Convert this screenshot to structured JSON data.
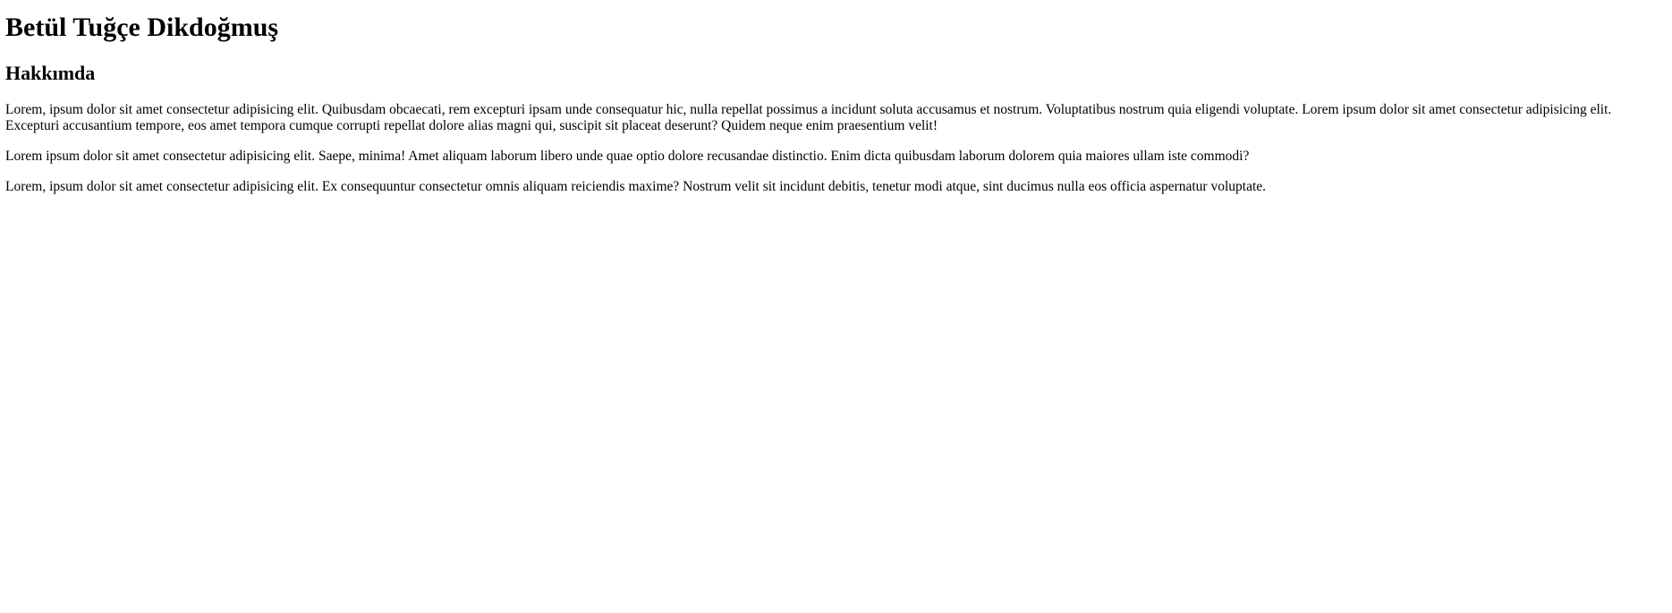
{
  "header": {
    "name": "Betül Tuğçe Dikdoğmuş"
  },
  "about": {
    "heading": "Hakkımda",
    "paragraphs": [
      "Lorem, ipsum dolor sit amet consectetur adipisicing elit. Quibusdam obcaecati, rem excepturi ipsam unde consequatur hic, nulla repellat possimus a incidunt soluta accusamus et nostrum. Voluptatibus nostrum quia eligendi voluptate. Lorem ipsum dolor sit amet consectetur adipisicing elit. Excepturi accusantium tempore, eos amet tempora cumque corrupti repellat dolore alias magni qui, suscipit sit placeat deserunt? Quidem neque enim praesentium velit!",
      "Lorem ipsum dolor sit amet consectetur adipisicing elit. Saepe, minima! Amet aliquam laborum libero unde quae optio dolore recusandae distinctio. Enim dicta quibusdam laborum dolorem quia maiores ullam iste commodi?",
      "Lorem, ipsum dolor sit amet consectetur adipisicing elit. Ex consequuntur consectetur omnis aliquam reiciendis maxime? Nostrum velit sit incidunt debitis, tenetur modi atque, sint ducimus nulla eos officia aspernatur voluptate."
    ]
  }
}
